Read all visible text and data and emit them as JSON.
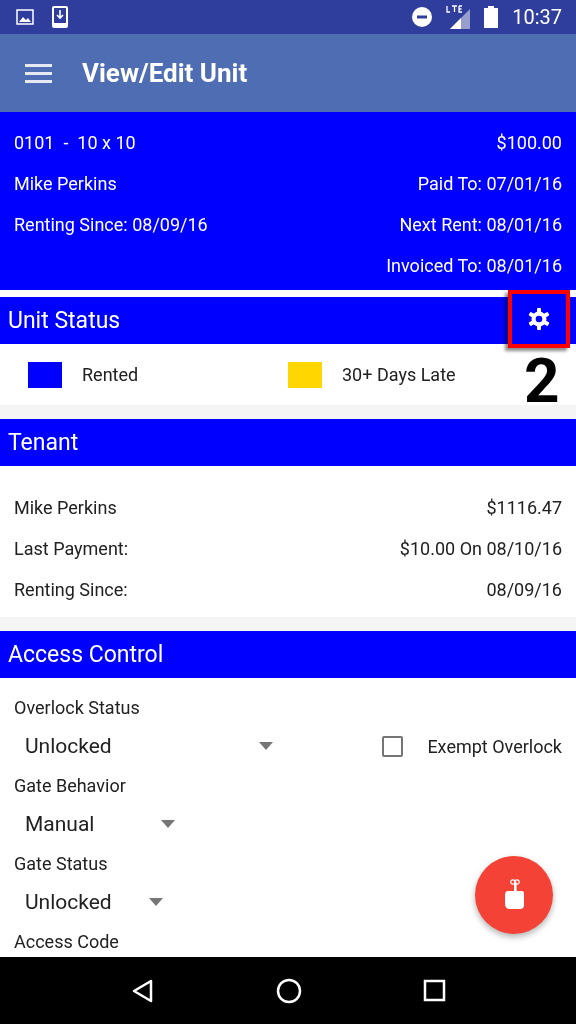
{
  "status_bar": {
    "time": "10:37"
  },
  "app_bar": {
    "title": "View/Edit Unit"
  },
  "unit_summary": {
    "rows": [
      {
        "left": "0101  -  10 x 10",
        "right": "$100.00"
      },
      {
        "left": "Mike Perkins",
        "right": "Paid To: 07/01/16"
      },
      {
        "left": "Renting Since: 08/09/16",
        "right": "Next Rent: 08/01/16"
      },
      {
        "right": "Invoiced To: 08/01/16"
      }
    ]
  },
  "unit_status": {
    "title": "Unit Status",
    "legend": [
      {
        "label": "Rented",
        "color": "#0000ff"
      },
      {
        "label": "30+ Days Late",
        "color": "#ffd600"
      }
    ]
  },
  "annotation": {
    "label": "2"
  },
  "tenant": {
    "title": "Tenant",
    "rows": [
      {
        "left": "Mike Perkins",
        "right": "$1116.47"
      },
      {
        "left": "Last Payment:",
        "right": "$10.00 On 08/10/16"
      },
      {
        "left": "Renting Since:",
        "right": "08/09/16"
      }
    ]
  },
  "access_control": {
    "title": "Access Control",
    "fields": [
      {
        "kind": "dropdown",
        "label": "Overlock Status",
        "value": "Unlocked",
        "checkbox": {
          "label": "Exempt Overlock",
          "checked": false
        }
      },
      {
        "kind": "dropdown",
        "label": "Gate Behavior",
        "value": "Manual"
      },
      {
        "kind": "dropdown",
        "label": "Gate Status",
        "value": "Unlocked"
      },
      {
        "kind": "label",
        "label": "Access Code"
      }
    ]
  }
}
